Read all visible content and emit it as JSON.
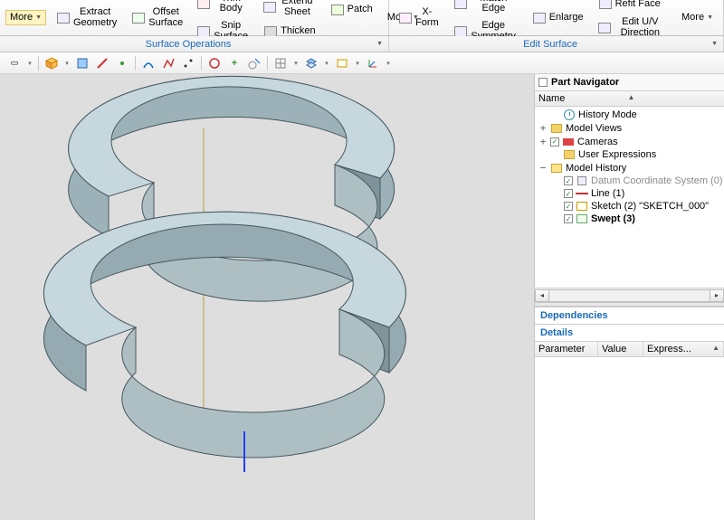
{
  "ribbon": {
    "left": {
      "more1": "More",
      "extract_geometry": "Extract\nGeometry",
      "offset_surface": "Offset\nSurface",
      "trim_body": "Trim Body",
      "extend_sheet": "Extend Sheet",
      "snip_surface": "Snip Surface",
      "patch": "Patch",
      "thicken": "Thicken",
      "more2": "More",
      "section_label": "Surface Operations"
    },
    "right": {
      "xform": "X-Form",
      "match_edge": "Match Edge",
      "edge_symmetry": "Edge Symmetry",
      "enlarge": "Enlarge",
      "refit_face": "Refit Face",
      "edit_uv": "Edit U/V Direction",
      "more": "More",
      "section_label": "Edit Surface"
    }
  },
  "navigator": {
    "title": "Part Navigator",
    "col_name": "Name",
    "items": {
      "history_mode": "History Mode",
      "model_views": "Model Views",
      "cameras": "Cameras",
      "user_expr": "User Expressions",
      "model_history": "Model History",
      "datum": "Datum Coordinate System (0)",
      "line": "Line (1)",
      "sketch": "Sketch (2) \"SKETCH_000\"",
      "swept": "Swept (3)"
    }
  },
  "dependencies": {
    "title": "Dependencies"
  },
  "details": {
    "title": "Details",
    "cols": {
      "parameter": "Parameter",
      "value": "Value",
      "expression": "Express..."
    }
  }
}
